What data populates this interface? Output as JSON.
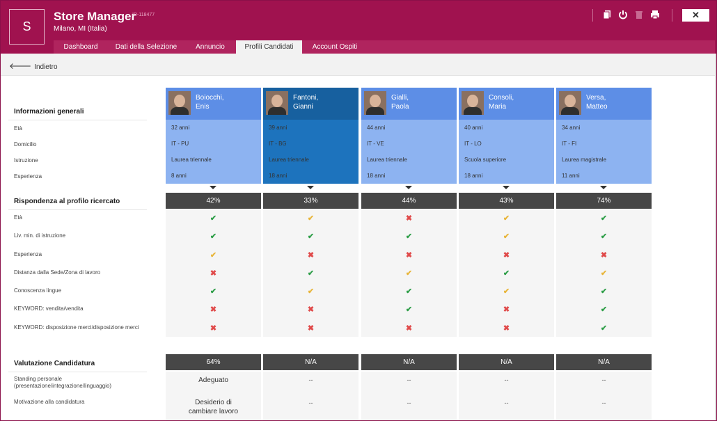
{
  "header": {
    "logo_letter": "S",
    "title": "Store Manager",
    "job_id": "ID-118477",
    "location": "Milano, MI (Italia)",
    "icons": [
      "copy-icon",
      "power-icon",
      "trash-icon",
      "print-icon"
    ],
    "close_glyph": "✕"
  },
  "tabs": [
    "Dashboard",
    "Dati della Selezione",
    "Annuncio",
    "Profili Candidati",
    "Account Ospiti"
  ],
  "active_tab": "Profili Candidati",
  "back_label": "Indietro",
  "general": {
    "title": "Informazioni generali",
    "rows": [
      "Età",
      "Domicilio",
      "Istruzione",
      "Esperienza"
    ]
  },
  "match": {
    "title": "Rispondenza al profilo ricercato",
    "criteria": [
      "Età",
      "Liv. min. di istruzione",
      "Esperienza",
      "Distanza dalla Sede/Zona di lavoro",
      "Conoscenza lingue",
      "KEYWORD: vendita/vendita",
      "KEYWORD: disposizione merci/disposizione merci"
    ]
  },
  "evaluation": {
    "title": "Valutazione Candidatura",
    "criteria": [
      "Standing personale (presentazione/integrazione/linguaggio)",
      "Motivazione alla candidatura"
    ]
  },
  "symbols": {
    "ok": "✔",
    "part": "✔",
    "no": "✖"
  },
  "colors": {
    "header": "#a0124f",
    "card": "#5d8ee6",
    "card_selected": "#17609f",
    "ok": "#2e9e48",
    "partial": "#e8b53a",
    "no": "#e04a4a"
  },
  "candidates": [
    {
      "first": "Boiocchi,",
      "last": "Enis",
      "eta": "32 anni",
      "domicilio": "IT - PU",
      "istruzione": "Laurea triennale",
      "esperienza": "8 anni",
      "score": "42%",
      "checks": [
        "ok",
        "ok",
        "part",
        "no",
        "ok",
        "no",
        "no"
      ],
      "eval_score": "64%",
      "eval": [
        "Adeguato",
        "Desiderio di cambiare lavoro"
      ]
    },
    {
      "first": "Fantoni,",
      "last": "Gianni",
      "eta": "39 anni",
      "domicilio": "IT - BG",
      "istruzione": "Laurea triennale",
      "esperienza": "18 anni",
      "score": "33%",
      "checks": [
        "part",
        "ok",
        "no",
        "ok",
        "part",
        "no",
        "no"
      ],
      "eval_score": "N/A",
      "eval": [
        "--",
        "--"
      ]
    },
    {
      "first": "Gialli,",
      "last": "Paola",
      "eta": "44 anni",
      "domicilio": "IT - VE",
      "istruzione": "Laurea triennale",
      "esperienza": "18 anni",
      "score": "44%",
      "checks": [
        "no",
        "ok",
        "no",
        "part",
        "ok",
        "ok",
        "no"
      ],
      "eval_score": "N/A",
      "eval": [
        "--",
        "--"
      ]
    },
    {
      "first": "Consoli,",
      "last": "Maria",
      "eta": "40 anni",
      "domicilio": "IT - LO",
      "istruzione": "Scuola superiore",
      "esperienza": "18 anni",
      "score": "43%",
      "checks": [
        "part",
        "part",
        "no",
        "ok",
        "part",
        "no",
        "no"
      ],
      "eval_score": "N/A",
      "eval": [
        "--",
        "--"
      ]
    },
    {
      "first": "Versa,",
      "last": "Matteo",
      "eta": "34 anni",
      "domicilio": "IT - FI",
      "istruzione": "Laurea magistrale",
      "esperienza": "11 anni",
      "score": "74%",
      "checks": [
        "ok",
        "ok",
        "no",
        "part",
        "ok",
        "ok",
        "ok"
      ],
      "eval_score": "N/A",
      "eval": [
        "--",
        "--"
      ]
    }
  ]
}
